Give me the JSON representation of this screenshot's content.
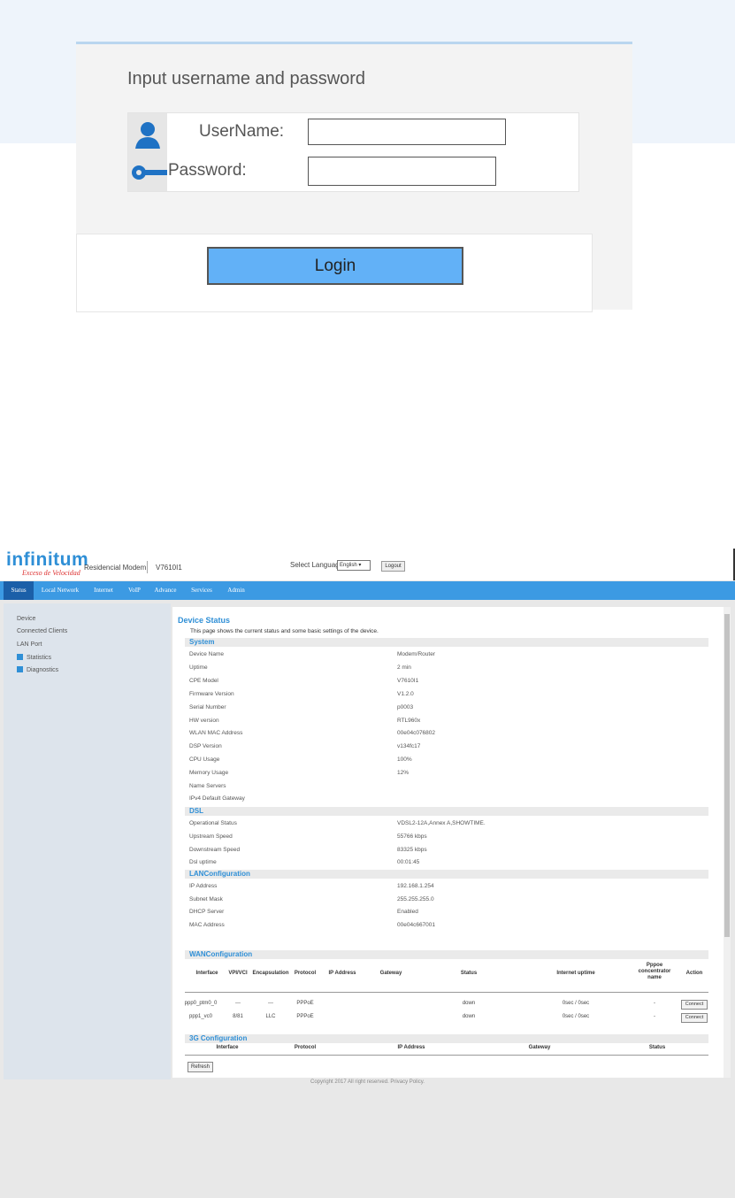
{
  "login": {
    "title": "Input username and password",
    "username_label": "UserName:",
    "password_label": "Password:",
    "username_value": "",
    "password_value": "",
    "login_button": "Login"
  },
  "header": {
    "logo_main": "infinitum",
    "logo_sub": "Exceso de Velocidad",
    "product": "Residencial Modem",
    "model": "V7610I1",
    "select_language_label": "Select Language",
    "language_value": "English",
    "logout_button": "Logout"
  },
  "nav": [
    "Status",
    "Local Network",
    "Internet",
    "VoIP",
    "Advance",
    "Services",
    "Admin"
  ],
  "sidebar": {
    "items": [
      "Device",
      "Connected Clients",
      "LAN Port",
      "Statistics",
      "Diagnostics"
    ]
  },
  "device_status": {
    "title": "Device Status",
    "description": "This page shows the current status and some basic settings of the device.",
    "system": {
      "heading": "System",
      "rows": [
        {
          "k": "Device Name",
          "v": "Modem/Router"
        },
        {
          "k": "Uptime",
          "v": "2 min"
        },
        {
          "k": "CPE Model",
          "v": "V7610I1"
        },
        {
          "k": "Firmware Version",
          "v": "V1.2.0"
        },
        {
          "k": "Serial Number",
          "v": "p0003"
        },
        {
          "k": "HW version",
          "v": "RTL960x"
        },
        {
          "k": "WLAN MAC Address",
          "v": "00e04c076802"
        },
        {
          "k": "DSP Version",
          "v": "v134fc17"
        },
        {
          "k": "CPU Usage",
          "v": "100%"
        },
        {
          "k": "Memory Usage",
          "v": "12%"
        },
        {
          "k": "Name Servers",
          "v": ""
        },
        {
          "k": "IPv4 Default Gateway",
          "v": ""
        }
      ]
    },
    "dsl": {
      "heading": "DSL",
      "rows": [
        {
          "k": "Operational Status",
          "v": "VDSL2-12A,Annex A,SHOWTIME."
        },
        {
          "k": "Upstream Speed",
          "v": "55766 kbps"
        },
        {
          "k": "Downstream Speed",
          "v": "83325 kbps"
        },
        {
          "k": "Dsl uptime",
          "v": "00:01:45"
        }
      ]
    },
    "lan": {
      "heading": "LANConfiguration",
      "rows": [
        {
          "k": "IP Address",
          "v": "192.168.1.254"
        },
        {
          "k": "Subnet Mask",
          "v": "255.255.255.0"
        },
        {
          "k": "DHCP Server",
          "v": "Enabled"
        },
        {
          "k": "MAC Address",
          "v": "00e04c667001"
        }
      ]
    },
    "wan": {
      "heading": "WANConfiguration",
      "columns": [
        "Interface",
        "VPI/VCI",
        "Encapsulation",
        "Protocol",
        "IP Address",
        "Gateway",
        "Status",
        "Internet uptime",
        "Pppoe concentrator name",
        "Action"
      ],
      "rows": [
        [
          "ppp0_ptm0_0",
          "---",
          "---",
          "PPPoE",
          "",
          "",
          "down",
          "0sec / 0sec",
          "-",
          "Connect"
        ],
        [
          "ppp1_vc0",
          "8/81",
          "LLC",
          "PPPoE",
          "",
          "",
          "down",
          "0sec / 0sec",
          "-",
          "Connect"
        ]
      ]
    },
    "g3": {
      "heading": "3G Configuration",
      "columns": [
        "Interface",
        "Protocol",
        "IP Address",
        "Gateway",
        "Status"
      ]
    },
    "refresh_button": "Refresh"
  },
  "footer": "Copyright 2017 All right reserved. Privacy Policy."
}
